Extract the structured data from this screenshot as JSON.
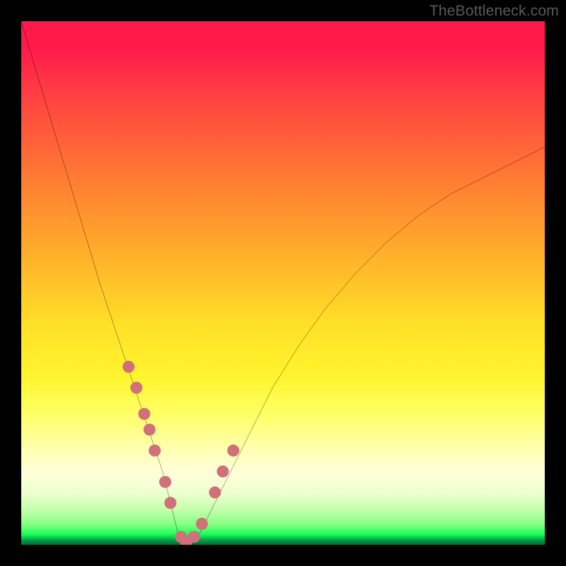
{
  "watermark": "TheBottleneck.com",
  "chart_data": {
    "type": "line",
    "title": "",
    "xlabel": "",
    "ylabel": "",
    "xlim": [
      0,
      100
    ],
    "ylim": [
      0,
      100
    ],
    "series": [
      {
        "name": "bottleneck-curve",
        "x": [
          0,
          3,
          6,
          9,
          12,
          15,
          18,
          21,
          24,
          27,
          29,
          30,
          31,
          32,
          34,
          37,
          40,
          44,
          48,
          53,
          58,
          64,
          70,
          76,
          82,
          88,
          94,
          100
        ],
        "y": [
          100,
          90,
          80,
          70,
          60,
          50,
          41,
          32,
          23,
          14,
          6,
          2,
          0,
          0,
          2,
          8,
          14,
          22,
          30,
          38,
          45,
          52,
          58,
          63,
          67,
          70,
          73,
          76
        ]
      }
    ],
    "marker_points": {
      "name": "highlighted-range",
      "color": "#d07078",
      "x": [
        20.5,
        22.0,
        23.5,
        24.5,
        25.5,
        27.5,
        28.5,
        30.5,
        31.5,
        33.0,
        34.5,
        37.0,
        38.5,
        40.5
      ],
      "y": [
        34.0,
        30.0,
        25.0,
        22.0,
        18.0,
        12.0,
        8.0,
        1.5,
        0.5,
        1.5,
        4.0,
        10.0,
        14.0,
        18.0
      ]
    },
    "gradient_stops": [
      {
        "pos": 0,
        "color": "#ff1a4b"
      },
      {
        "pos": 0.3,
        "color": "#ff7b33"
      },
      {
        "pos": 0.58,
        "color": "#ffe028"
      },
      {
        "pos": 0.82,
        "color": "#ffffb3"
      },
      {
        "pos": 0.96,
        "color": "#8aff86"
      },
      {
        "pos": 1.0,
        "color": "#006b37"
      }
    ]
  }
}
